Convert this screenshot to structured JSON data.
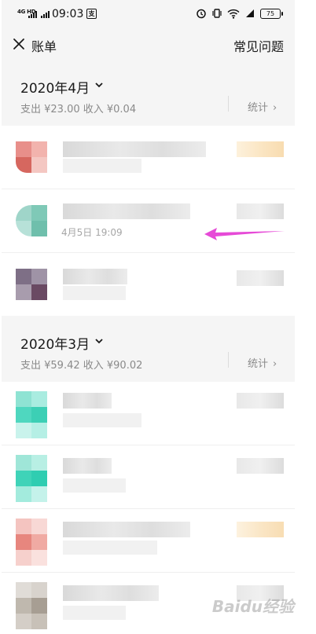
{
  "status_bar": {
    "signal_1": "4G HD",
    "signal_2": "4G HD",
    "time": "09:03",
    "battery": "75"
  },
  "nav": {
    "title": "账单",
    "faq": "常见问题"
  },
  "months": [
    {
      "title": "2020年4月",
      "summary": "支出 ¥23.00  收入 ¥0.04",
      "stats_label": "统计",
      "transactions": [
        {
          "date": ""
        },
        {
          "date": "4月5日 19:09"
        },
        {
          "date": ""
        }
      ]
    },
    {
      "title": "2020年3月",
      "summary": "支出 ¥59.42  收入 ¥90.02",
      "stats_label": "统计",
      "transactions": [
        {
          "date": ""
        },
        {
          "date": ""
        },
        {
          "date": ""
        },
        {
          "date": ""
        }
      ]
    }
  ],
  "colors": {
    "annotation_arrow": "#e64ad7",
    "page_bg": "#f5f5f5",
    "muted_text": "#8a8a8a"
  },
  "watermark": "Baidu经验"
}
